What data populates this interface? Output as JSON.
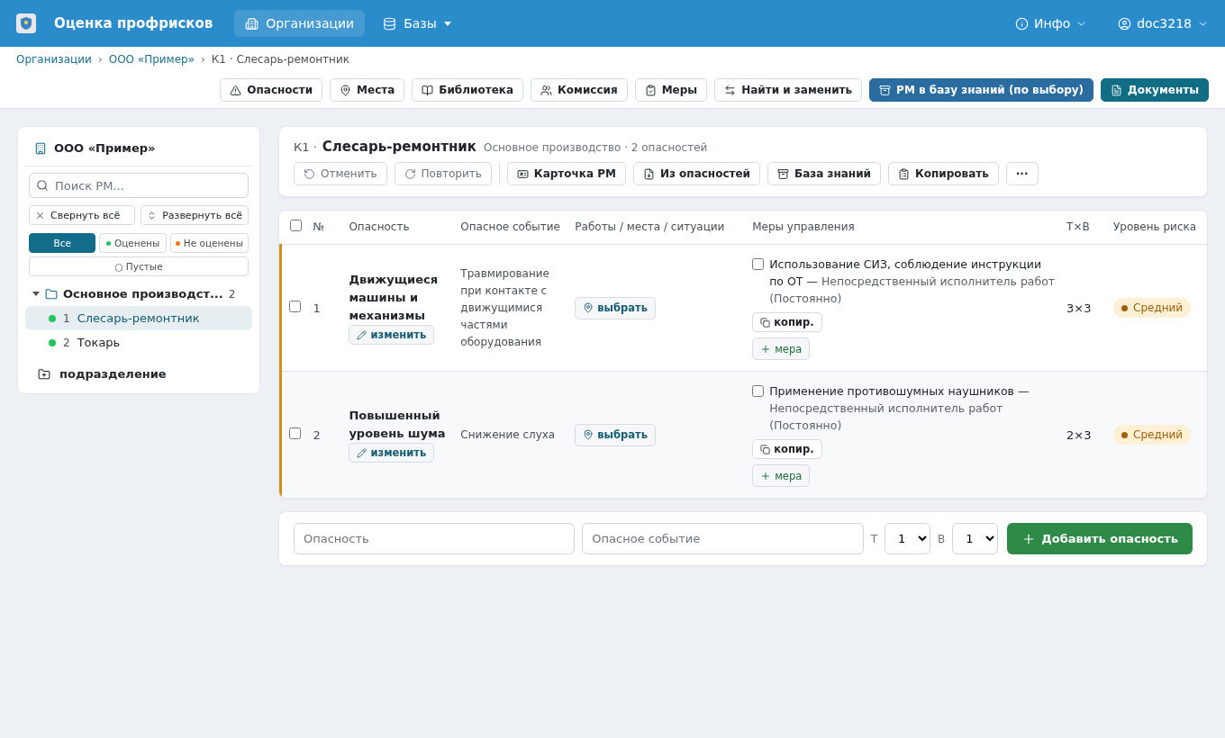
{
  "app": {
    "title": "Оценка профрисков",
    "nav": [
      {
        "label": "Организации",
        "selected": true
      },
      {
        "label": "Базы",
        "selected": false,
        "dropdown": true
      }
    ],
    "user_menu": [
      {
        "label": "Инфо"
      },
      {
        "label": "doc3218"
      }
    ]
  },
  "breadcrumbs": {
    "separator": "›",
    "items": [
      {
        "label": "Организации",
        "link": true
      },
      {
        "label": "ООО «Пример»",
        "link": true
      },
      {
        "label": "К1 · Слесарь-ремонтник",
        "link": false
      }
    ]
  },
  "toolbar": [
    {
      "label": "Опасности",
      "kind": "outline"
    },
    {
      "label": "Места",
      "kind": "outline"
    },
    {
      "label": "Библиотека",
      "kind": "outline"
    },
    {
      "label": "Комиссия",
      "kind": "outline"
    },
    {
      "label": "Меры",
      "kind": "outline"
    },
    {
      "label": "Найти и заменить",
      "kind": "outline"
    },
    {
      "label": "РМ в базу знаний (по выбору)",
      "kind": "primary"
    },
    {
      "label": "Документы",
      "kind": "teal"
    }
  ],
  "sidebar": {
    "org": "ООО «Пример»",
    "search": {
      "placeholder": "Поиск РМ..."
    },
    "buttons": [
      "Свернуть всё",
      "Развернуть всё"
    ],
    "filters": [
      {
        "label": "Все",
        "selected": true
      },
      {
        "label": "Оценены",
        "selected": false,
        "color": "#22c55e"
      },
      {
        "label": "Не оценены",
        "selected": false,
        "color": "#f97316"
      },
      {
        "label": "○ Пустые",
        "selected": false
      }
    ],
    "tree": [
      {
        "label": "Основное производст...",
        "count": "2",
        "expanded": true,
        "children": [
          {
            "number": "1",
            "label": "Слесарь-ремонтник",
            "selected": true,
            "color": "#22c55e"
          },
          {
            "number": "2",
            "label": "Токарь",
            "selected": false,
            "color": "#22c55e"
          }
        ]
      }
    ],
    "add_unit": "подразделение"
  },
  "workplace": {
    "code": "К1 ·",
    "title": "Слесарь-ремонтник",
    "subtitle": "Основное производство · 2 опасностей",
    "actions": [
      {
        "label": "Отменить",
        "disabled": true
      },
      {
        "label": "Повторить",
        "disabled": true
      },
      {
        "label": "Карточка РМ",
        "disabled": false
      },
      {
        "label": "Из опасностей",
        "disabled": false
      },
      {
        "label": "База знаний",
        "disabled": false
      },
      {
        "label": "Копировать",
        "disabled": false
      },
      {
        "label": "···",
        "disabled": false
      }
    ]
  },
  "table": {
    "all_checked": false,
    "columns": [
      "№",
      "Опасность",
      "Опасное событие",
      "Работы / места / ситуации",
      "Меры управления",
      "Т×В",
      "Уровень риска"
    ],
    "rows": [
      {
        "checked": false,
        "number": "1",
        "hazard": "Движущиеся машины и механизмы",
        "edit": "изменить",
        "event": "Травмирование при контакте с движущимися частями оборудования",
        "place": "выбрать",
        "measures": [
          {
            "checked": false,
            "text": "Использование СИЗ, соблюдение инструкции по ОТ —",
            "note": "Непосредственный исполнитель работ (Постоянно)"
          }
        ],
        "copy": "копир.",
        "add_measure": "мера",
        "score": "3×3",
        "risk": {
          "label": "Средний",
          "color": "#a16207"
        }
      },
      {
        "checked": false,
        "number": "2",
        "hazard": "Повышенный уровень шума",
        "edit": "изменить",
        "event": "Снижение слуха",
        "place": "выбрать",
        "measures": [
          {
            "checked": false,
            "text": "Применение противошумных наушников —",
            "note": "Непосредственный исполнитель работ (Постоянно)"
          }
        ],
        "copy": "копир.",
        "add_measure": "мера",
        "score": "2×3",
        "risk": {
          "label": "Средний",
          "color": "#a16207"
        }
      }
    ]
  },
  "add_form": {
    "hazard_placeholder": "Опасность",
    "event_placeholder": "Опасное событие",
    "t_label": "Т",
    "t_value": "1",
    "v_label": "В",
    "v_value": "1",
    "button": "Добавить опасность"
  }
}
